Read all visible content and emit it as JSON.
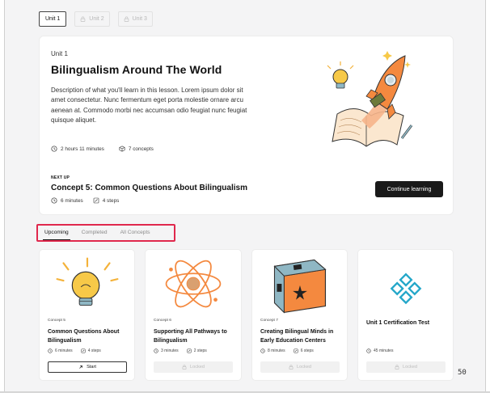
{
  "unit_tabs": [
    {
      "label": "Unit 1",
      "locked": false
    },
    {
      "label": "Unit 2",
      "locked": true
    },
    {
      "label": "Unit 3",
      "locked": true
    }
  ],
  "hero": {
    "eyebrow": "Unit 1",
    "title": "Bilingualism Around The World",
    "description": "Description of what you'll learn in this lesson. Lorem ipsum dolor sit amet consectetur. Nunc fermentum eget porta molestie ornare arcu aenean at. Commodo morbi nec accumsan odio feugiat nunc feugiat quisque aliquet.",
    "duration": "2 hours 11 minutes",
    "concepts": "7 concepts",
    "next_up_label": "NEXT UP",
    "next_title": "Concept 5: Common Questions About Bilingualism",
    "next_duration": "6 minutes",
    "next_steps": "4 steps",
    "continue_label": "Continue learning"
  },
  "filter_tabs": [
    {
      "label": "Upcoming",
      "active": true
    },
    {
      "label": "Completed",
      "active": false
    },
    {
      "label": "All Concepts",
      "active": false
    }
  ],
  "cards": [
    {
      "label": "Concept 5",
      "title": "Common Questions About Bilingualism",
      "duration": "6 minutes",
      "steps": "4 steps",
      "button": "Start",
      "locked": false
    },
    {
      "label": "Concept 6",
      "title": "Supporting All Pathways to Bilingualism",
      "duration": "3 minutes",
      "steps": "2 steps",
      "button": "Locked",
      "locked": true
    },
    {
      "label": "Concept 7",
      "title": "Creating Bilingual Minds in Early Education Centers",
      "duration": "8 minutes",
      "steps": "6 steps",
      "button": "Locked",
      "locked": true
    },
    {
      "label": "",
      "title": "Unit 1 Certification Test",
      "duration": "45 minutes",
      "steps": "",
      "button": "Locked",
      "locked": true
    }
  ],
  "page_number": "50",
  "colors": {
    "accent": "#e0284d",
    "primary_button": "#1a1a1a",
    "orange": "#f4893f",
    "teal": "#24a7c9"
  }
}
